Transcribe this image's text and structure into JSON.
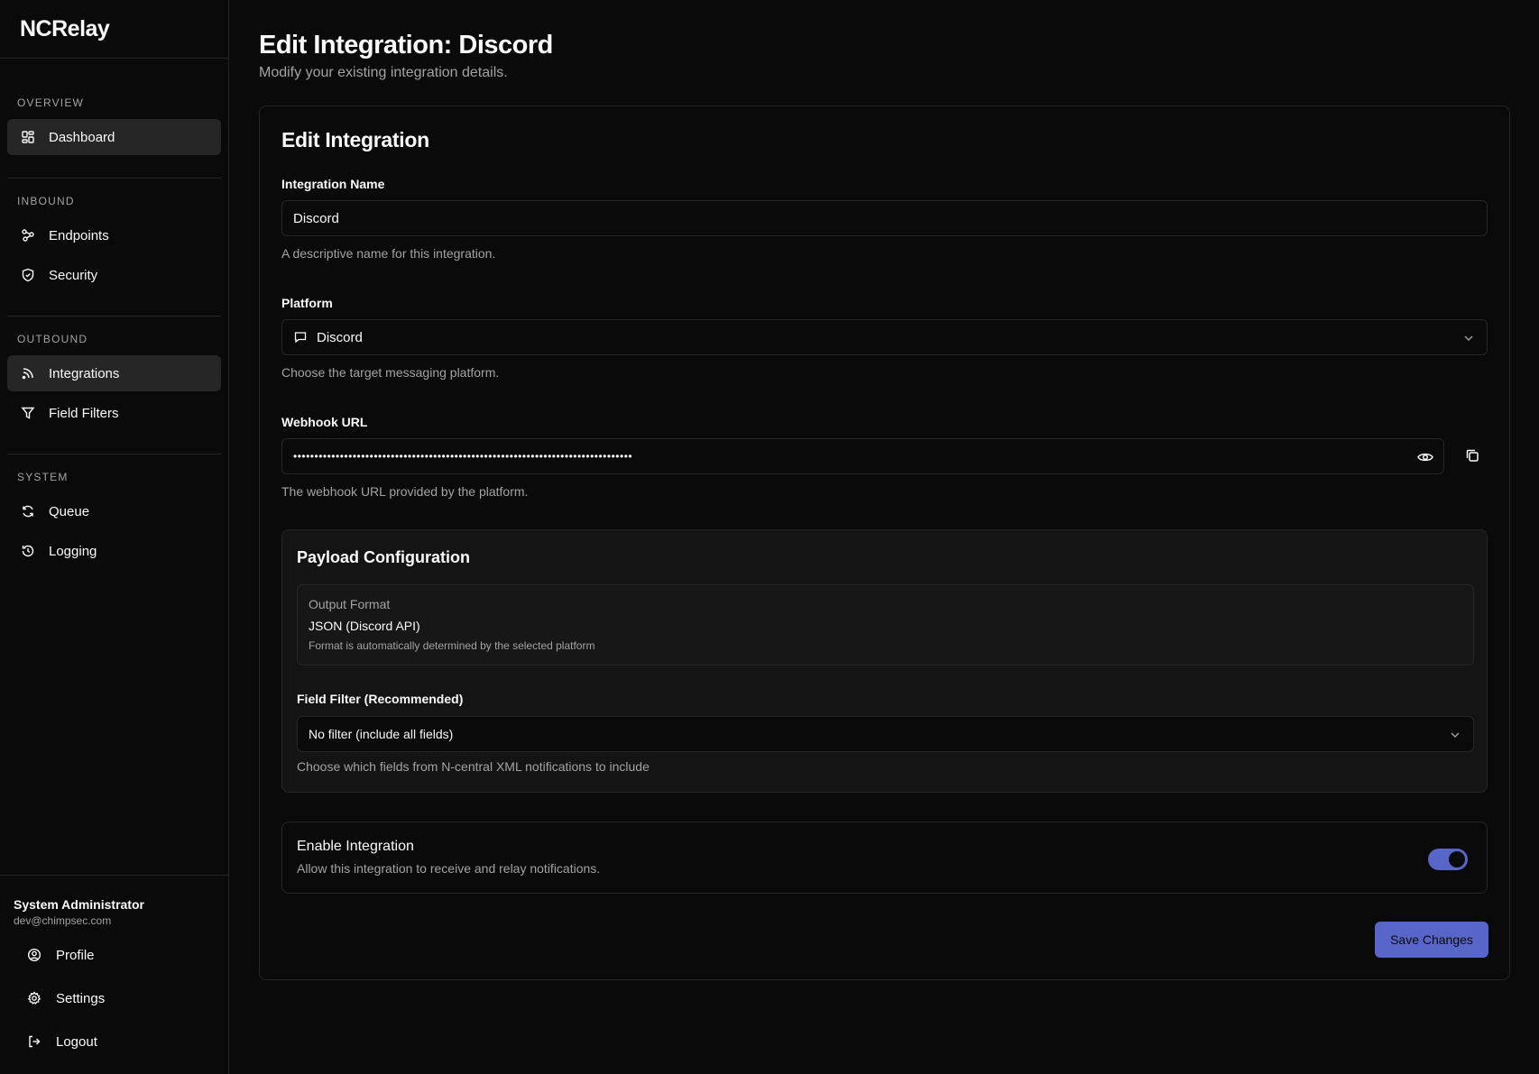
{
  "app": {
    "title": "NCRelay"
  },
  "sidebar": {
    "sections": [
      {
        "title": "OVERVIEW",
        "items": [
          {
            "label": "Dashboard",
            "icon": "dashboard-icon"
          }
        ]
      },
      {
        "title": "INBOUND",
        "items": [
          {
            "label": "Endpoints",
            "icon": "endpoints-icon"
          },
          {
            "label": "Security",
            "icon": "shield-icon"
          }
        ]
      },
      {
        "title": "OUTBOUND",
        "items": [
          {
            "label": "Integrations",
            "icon": "rss-icon"
          },
          {
            "label": "Field Filters",
            "icon": "filter-icon"
          }
        ]
      },
      {
        "title": "SYSTEM",
        "items": [
          {
            "label": "Queue",
            "icon": "refresh-icon"
          },
          {
            "label": "Logging",
            "icon": "history-icon"
          }
        ]
      }
    ],
    "active_item": "Integrations",
    "user": {
      "name": "System Administrator",
      "email": "dev@chimpsec.com"
    },
    "footer": {
      "profile": "Profile",
      "settings": "Settings",
      "logout": "Logout"
    }
  },
  "page": {
    "title": "Edit Integration: Discord",
    "subtitle": "Modify your existing integration details."
  },
  "form": {
    "card_title": "Edit Integration",
    "name": {
      "label": "Integration Name",
      "value": "Discord",
      "hint": "A descriptive name for this integration."
    },
    "platform": {
      "label": "Platform",
      "value": "Discord",
      "hint": "Choose the target messaging platform."
    },
    "webhook": {
      "label": "Webhook URL",
      "value": "••••••••••••••••••••••••••••••••••••••••••••••••••••••••••••••••••••••••••••••••",
      "hint": "The webhook URL provided by the platform."
    },
    "payload": {
      "title": "Payload Configuration",
      "output_format_label": "Output Format",
      "output_format_value": "JSON (Discord API)",
      "output_format_note": "Format is automatically determined by the selected platform",
      "field_filter_label": "Field Filter (Recommended)",
      "field_filter_value": "No filter (include all fields)",
      "field_filter_hint": "Choose which fields from N-central XML notifications to include"
    },
    "enable": {
      "title": "Enable Integration",
      "desc": "Allow this integration to receive and relay notifications.",
      "checked": true
    },
    "save_label": "Save Changes"
  },
  "colors": {
    "accent": "#5865c9",
    "background": "#0a0a0a",
    "border": "#262626",
    "muted": "#a3a3a3"
  }
}
